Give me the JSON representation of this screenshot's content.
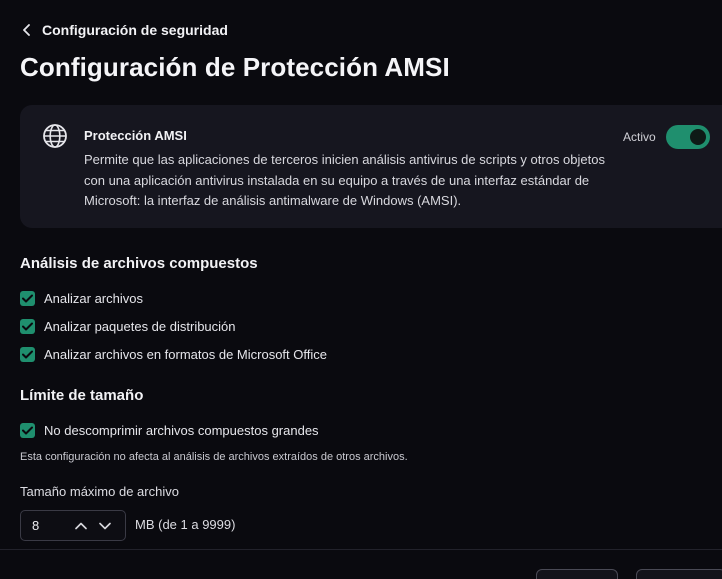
{
  "back": {
    "label": "Configuración de seguridad"
  },
  "page": {
    "title": "Configuración de Protección AMSI"
  },
  "amsi_card": {
    "title": "Protección AMSI",
    "description": "Permite que las aplicaciones de terceros inicien análisis antivirus de scripts y otros objetos con una aplicación antivirus instalada en su equipo a través de una interfaz estándar de Microsoft: la interfaz de análisis antimalware de Windows (AMSI).",
    "status": "Activo",
    "enabled": true,
    "icon": "globe-icon"
  },
  "compound": {
    "title": "Análisis de archivos compuestos",
    "options": [
      {
        "label": "Analizar archivos",
        "checked": true
      },
      {
        "label": "Analizar paquetes de distribución",
        "checked": true
      },
      {
        "label": "Analizar archivos en formatos de Microsoft Office",
        "checked": true
      }
    ]
  },
  "size_limit": {
    "title": "Límite de tamaño",
    "option": {
      "label": "No descomprimir archivos compuestos grandes",
      "checked": true
    },
    "note": "Esta configuración no afecta al análisis de archivos extraídos de otros archivos.",
    "field_label": "Tamaño máximo de archivo",
    "value": "8",
    "units": "MB (de 1 a 9999)"
  },
  "colors": {
    "accent": "#1f8f6e",
    "background": "#0a0a0f",
    "card": "#16161f"
  }
}
